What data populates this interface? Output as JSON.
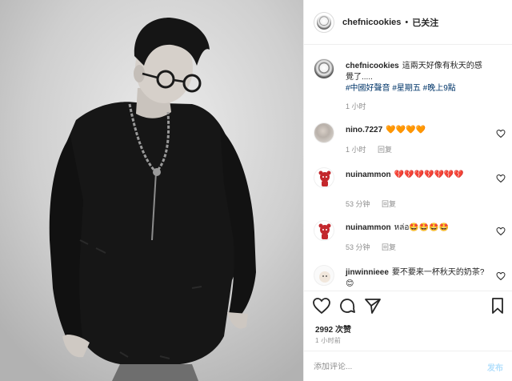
{
  "header": {
    "username": "chefnicookies",
    "separator": "•",
    "follow_label": "已关注"
  },
  "caption": {
    "username": "chefnicookies",
    "text": "這兩天好像有秋天的感覺了.....",
    "tags": "#中國好聲音 #星期五 #晚上9點",
    "time": "1 小时"
  },
  "comments": [
    {
      "username": "nino.7227",
      "text": "🧡🧡🧡🧡",
      "time": "1 小时",
      "reply": "回复"
    },
    {
      "username": "nuinammon",
      "text": "💔💔💔💔💔💔💔",
      "time": "53 分钟",
      "reply": "回复"
    },
    {
      "username": "nuinammon",
      "text": "หล่อ🤩🤩🤩🤩",
      "time": "53 分钟",
      "reply": "回复"
    },
    {
      "username": "jinwinnieee",
      "text": "要不要来一杯秋天的奶茶? 😊",
      "time": "",
      "reply": ""
    }
  ],
  "actions": {
    "likes": "2992 次赞",
    "time": "1 小时前",
    "comment_placeholder": "添加评论...",
    "post_label": "发布"
  },
  "colors": {
    "text": "#262626",
    "meta": "#8e8e8e",
    "hashtag": "#003569",
    "post_button": "#b2dffc",
    "border": "#efefef"
  },
  "icons": [
    "heart-icon",
    "comment-icon",
    "share-icon",
    "bookmark-icon"
  ]
}
